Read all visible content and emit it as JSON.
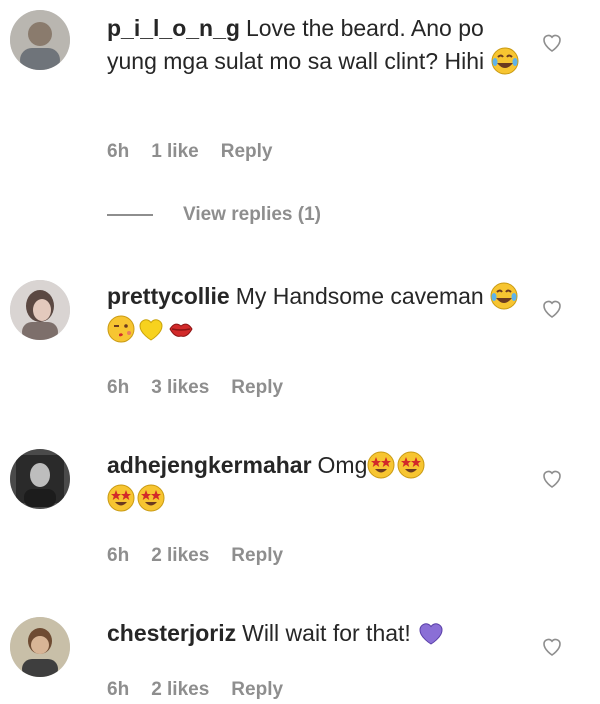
{
  "comments": [
    {
      "username": "p_i_l_o_n_g",
      "text": "Love the beard. Ano po yung mga sulat mo sa wall clint? Hihi",
      "emojis": [
        "face-with-tears-of-joy-emoji"
      ],
      "time": "6h",
      "likes": "1 like",
      "reply": "Reply",
      "view_replies": "View replies (1)"
    },
    {
      "username": "prettycollie",
      "text": "My Handsome caveman",
      "emojis": [
        "face-with-tears-of-joy-emoji",
        "winking-kiss-face-emoji",
        "yellow-heart-emoji",
        "kiss-mark-emoji"
      ],
      "time": "6h",
      "likes": "3 likes",
      "reply": "Reply"
    },
    {
      "username": "adhejengkermahar",
      "text": "Omg",
      "emojis": [
        "star-struck-emoji",
        "star-struck-emoji",
        "star-struck-emoji",
        "star-struck-emoji"
      ],
      "time": "6h",
      "likes": "2 likes",
      "reply": "Reply"
    },
    {
      "username": "chesterjoriz",
      "text": "Will wait for that!",
      "emojis": [
        "purple-heart-emoji"
      ],
      "time": "6h",
      "likes": "2 likes",
      "reply": "Reply"
    }
  ],
  "colors": {
    "text": "#262626",
    "muted": "#8e8e8e",
    "heart_outline": "#8e8e8e",
    "emoji_yellow": "#f7c531",
    "emoji_red": "#d22a2a",
    "purple_heart": "#8a6fd6"
  }
}
